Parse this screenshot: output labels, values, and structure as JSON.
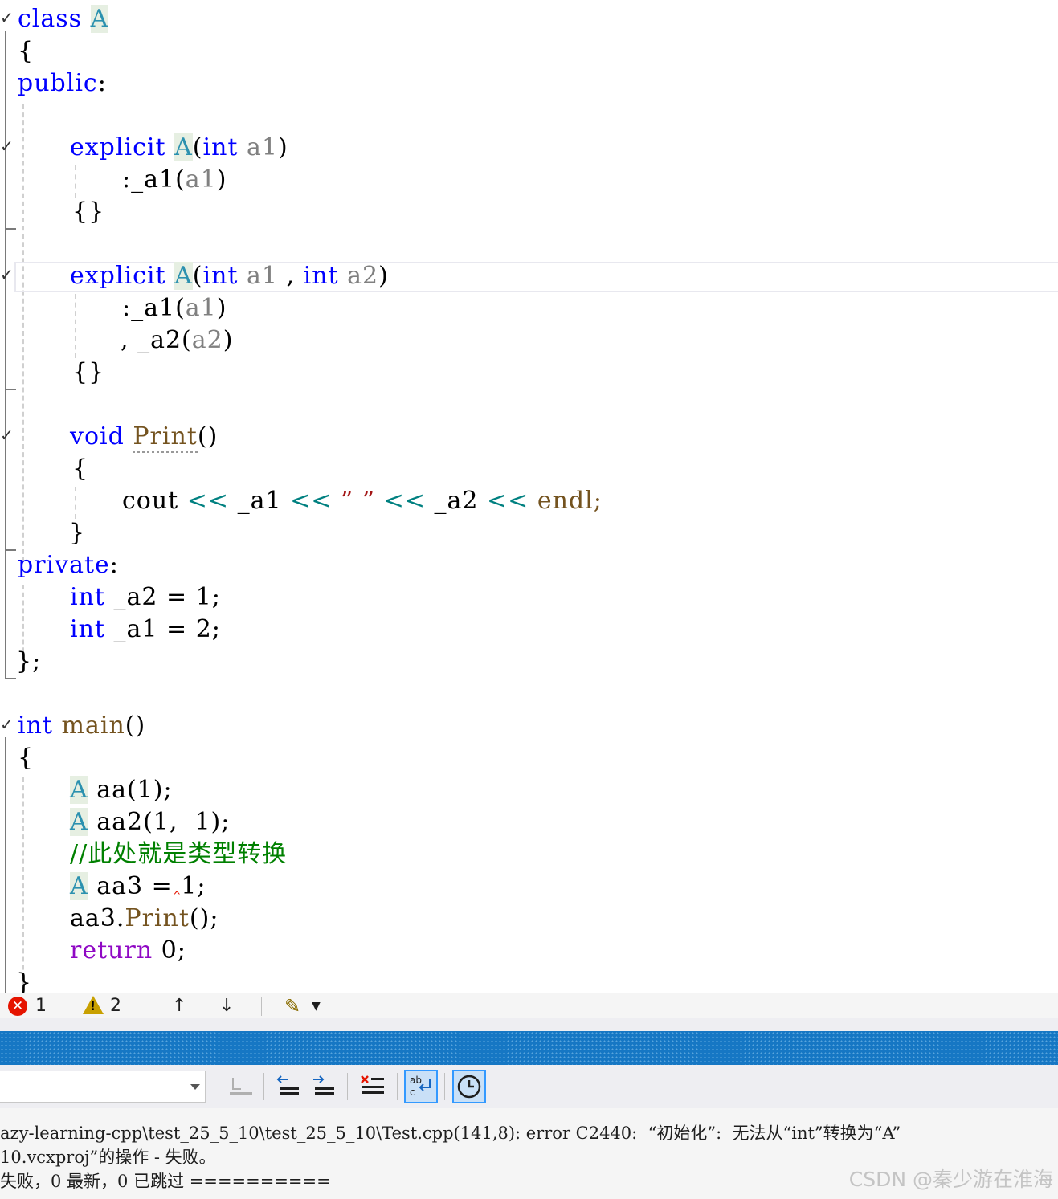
{
  "code": {
    "l1": {
      "kw": "class",
      "ty": "A"
    },
    "l2": "{",
    "l3": {
      "kw": "public",
      "tail": ":"
    },
    "l5": {
      "kw": "explicit",
      "ty": "A",
      "open": "(",
      "kw2": "int",
      "pa": "a1",
      "close": ")"
    },
    "l6": {
      "pre": ":_a1(",
      "pa": "a1",
      "post": ")"
    },
    "l7": "{}",
    "l9": {
      "kw": "explicit",
      "ty": "A",
      "open": "(",
      "kw2": "int",
      "pa": "a1",
      "comma": " , ",
      "kw3": "int",
      "pa2": "a2",
      "close": ")"
    },
    "l10": {
      "pre": ":_a1(",
      "pa": "a1",
      "post": ")"
    },
    "l11": {
      "pre": ", _a2(",
      "pa": "a2",
      "post": ")"
    },
    "l12": "{}",
    "l14": {
      "kw": "void",
      "fn": "Print",
      "post": "()"
    },
    "l15": "{",
    "l16": {
      "a": "cout ",
      "op1": "<<",
      "b": " _a1 ",
      "op2": "<<",
      "st": " ” ” ",
      "op3": "<<",
      "c": " _a2 ",
      "op4": "<<",
      "d": " endl;"
    },
    "l17": "}",
    "l18": {
      "kw": "private",
      "tail": ":"
    },
    "l19": {
      "kw": "int",
      "rest": " _a2 = 1;"
    },
    "l20": {
      "kw": "int",
      "rest": " _a1 = 2;"
    },
    "l21": "};",
    "l23": {
      "kw": "int",
      "fn": "main",
      "post": "()"
    },
    "l24": "{",
    "l25": {
      "ty": "A",
      "rest": " aa(1);"
    },
    "l26": {
      "ty": "A",
      "rest": " aa2(1,  1);"
    },
    "l27": "//此处就是类型转换",
    "l28": {
      "ty": "A",
      "rest": " aa3 = 1;"
    },
    "l29": {
      "a": "aa3.",
      "fn": "Print",
      "b": "();"
    },
    "l30": {
      "ctl": "return",
      "rest": " 0;"
    },
    "l31": "}"
  },
  "status": {
    "errors": "1",
    "warnings": "2",
    "up": "↑",
    "down": "↓"
  },
  "output": {
    "line1": "azy-learning-cpp\\test_25_5_10\\test_25_5_10\\Test.cpp(141,8): error C2440:  “初始化”:  无法从“int”转换为“A”",
    "line2": "10.vcxproj”的操作 - 失败。",
    "line3": "失败，0 最新，0 已跳过 ==========",
    "watermark": "CSDN @秦少游在淮海"
  },
  "colors": {
    "keyword": "#0000ff",
    "type": "#2b91af",
    "function": "#74531f",
    "param": "#808080",
    "comment": "#008000",
    "string": "#a31515",
    "control": "#8f08c4",
    "error": "#e51400",
    "accent": "#1677c4"
  }
}
